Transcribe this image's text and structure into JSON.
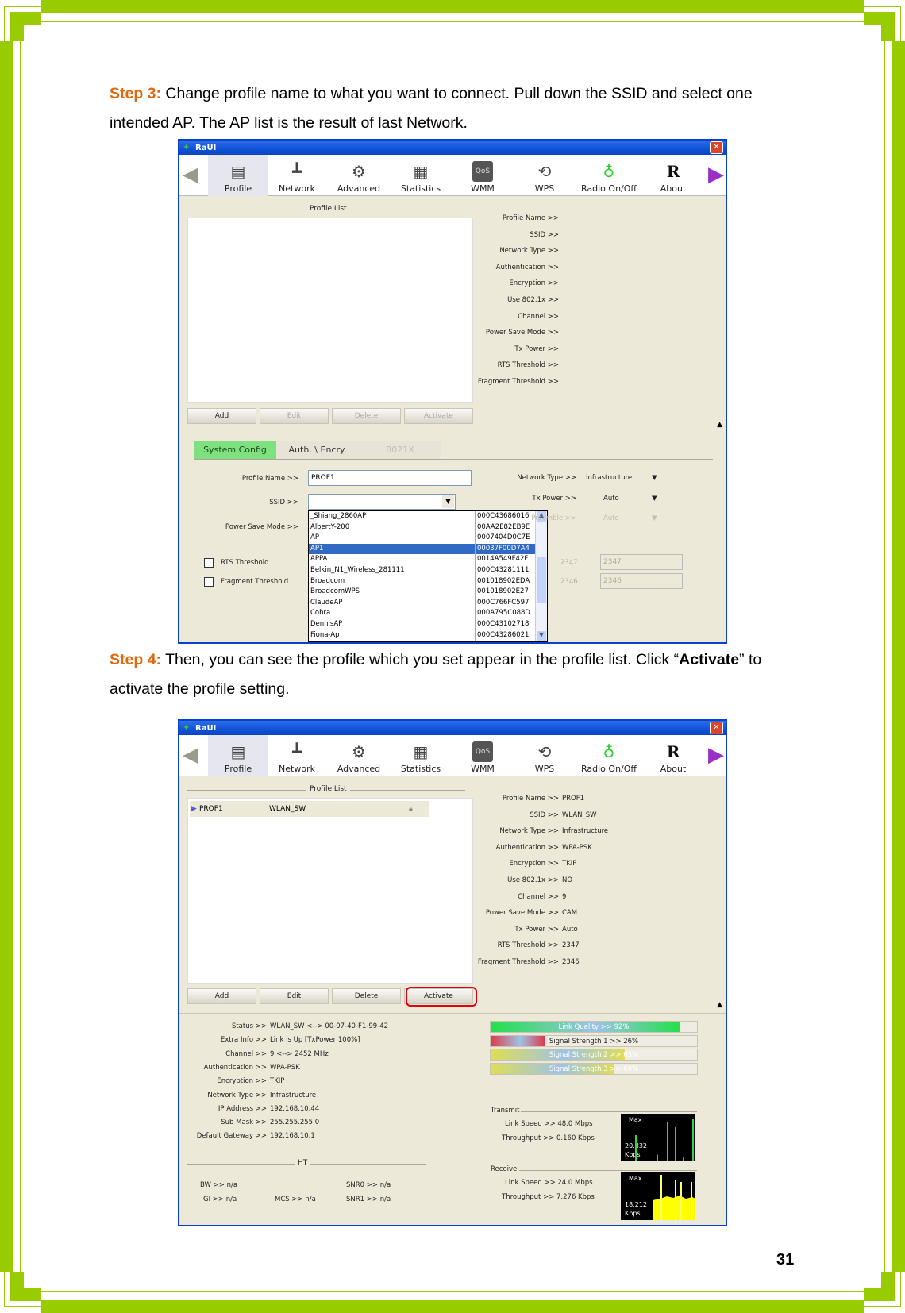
{
  "page": {
    "page_number": "31",
    "border_color": "#99cc00",
    "step3": {
      "label": "Step 3:",
      "text": " Change profile name to what you want to connect. Pull down the SSID and select one intended AP. The AP list is the result of last Network."
    },
    "step4": {
      "label": "Step 4:",
      "text_before": " Then, you can see the profile which you set appear in the profile list. Click “",
      "bold": "Activate",
      "text_after": "” to activate the profile setting."
    }
  },
  "app": {
    "title": "RaUI",
    "toolbar": [
      "Profile",
      "Network",
      "Advanced",
      "Statistics",
      "WMM",
      "WPS",
      "Radio On/Off",
      "About"
    ],
    "profile_list_title": "Profile List",
    "buttons": {
      "add": "Add",
      "edit": "Edit",
      "delete": "Delete",
      "activate": "Activate"
    }
  },
  "screen1": {
    "detail_labels": [
      "Profile Name >>",
      "SSID >>",
      "Network Type >>",
      "Authentication >>",
      "Encryption >>",
      "Use 802.1x >>",
      "Channel >>",
      "Power Save Mode >>",
      "Tx Power >>",
      "RTS Threshold >>",
      "Fragment Threshold >>"
    ],
    "tabs": [
      "System Config",
      "Auth. \\ Encry.",
      "8021X"
    ],
    "form": {
      "profile_name_label": "Profile Name >>",
      "profile_name_value": "PROF1",
      "ssid_label": "SSID >>",
      "ssid_value": "",
      "power_save_label": "Power Save Mode >>",
      "rts_label": "RTS Threshold",
      "frag_label": "Fragment Threshold",
      "network_type_label": "Network Type >>",
      "network_type_value": "Infrastructure",
      "tx_power_label": "Tx Power >>",
      "tx_power_value": "Auto",
      "preamble_label": "Preamble >>",
      "preamble_value": "Auto",
      "rts_value": "2347",
      "rts_input": "2347",
      "frag_value": "2346",
      "frag_input": "2346"
    },
    "ap_list": [
      {
        "ssid": "_Shiang_2860AP",
        "mac": "000C43686016"
      },
      {
        "ssid": "AlbertY-200",
        "mac": "00AA2E82EB9E"
      },
      {
        "ssid": "AP",
        "mac": "0007404D0C7E"
      },
      {
        "ssid": "AP1",
        "mac": "00037F00D7A4",
        "selected": true
      },
      {
        "ssid": "APPA",
        "mac": "0014A549F42F"
      },
      {
        "ssid": "Belkin_N1_Wireless_281111",
        "mac": "000C43281111"
      },
      {
        "ssid": "Broadcom",
        "mac": "001018902EDA"
      },
      {
        "ssid": "BroadcomWPS",
        "mac": "001018902E27"
      },
      {
        "ssid": "ClaudeAP",
        "mac": "000C766FC597"
      },
      {
        "ssid": "Cobra",
        "mac": "000A795C088D"
      },
      {
        "ssid": "DennisAP",
        "mac": "000C43102718"
      },
      {
        "ssid": "Fiona-Ap",
        "mac": "000C43286021"
      }
    ]
  },
  "screen2": {
    "profile_row": {
      "name": "PROF1",
      "ssid": "WLAN_SW"
    },
    "details": [
      {
        "label": "Profile Name >>",
        "value": "PROF1"
      },
      {
        "label": "SSID >>",
        "value": "WLAN_SW"
      },
      {
        "label": "Network Type >>",
        "value": "Infrastructure"
      },
      {
        "label": "Authentication >>",
        "value": "WPA-PSK"
      },
      {
        "label": "Encryption >>",
        "value": "TKIP"
      },
      {
        "label": "Use 802.1x >>",
        "value": "NO"
      },
      {
        "label": "Channel >>",
        "value": "9"
      },
      {
        "label": "Power Save Mode >>",
        "value": "CAM"
      },
      {
        "label": "Tx Power >>",
        "value": "Auto"
      },
      {
        "label": "RTS Threshold >>",
        "value": "2347"
      },
      {
        "label": "Fragment Threshold >>",
        "value": "2346"
      }
    ],
    "status": [
      {
        "label": "Status >>",
        "value": "WLAN_SW <--> 00-07-40-F1-99-42"
      },
      {
        "label": "Extra Info >>",
        "value": "Link is Up [TxPower:100%]"
      },
      {
        "label": "Channel >>",
        "value": "9 <--> 2452 MHz"
      },
      {
        "label": "Authentication >>",
        "value": "WPA-PSK"
      },
      {
        "label": "Encryption >>",
        "value": "TKIP"
      },
      {
        "label": "Network Type >>",
        "value": "Infrastructure"
      },
      {
        "label": "IP Address >>",
        "value": "192.168.10.44"
      },
      {
        "label": "Sub Mask >>",
        "value": "255.255.255.0"
      },
      {
        "label": "Default Gateway >>",
        "value": "192.168.10.1"
      }
    ],
    "ht": {
      "title": "HT",
      "bw": "BW >> n/a",
      "gi": "GI >> n/a",
      "mcs": "MCS >> n/a",
      "snr0": "SNR0 >> n/a",
      "snr1": "SNR1 >> n/a"
    },
    "signal": [
      {
        "label": "Link Quality >> 92%",
        "percent": 92,
        "color": "#22e04a"
      },
      {
        "label": "Signal Strength 1 >> 26%",
        "percent": 26,
        "color": "#e03a4a"
      },
      {
        "label": "Signal Strength 2 >> 65%",
        "percent": 65,
        "color": "#e0dd55"
      },
      {
        "label": "Signal Strength 3 >> 60%",
        "percent": 60,
        "color": "#e0dd55"
      }
    ],
    "transmit": {
      "title": "Transmit",
      "link_speed": "Link Speed >> 48.0 Mbps",
      "throughput": "Throughput >> 0.160 Kbps",
      "max_label": "Max",
      "max_value": "20.832",
      "unit": "Kbps"
    },
    "receive": {
      "title": "Receive",
      "link_speed": "Link Speed >> 24.0 Mbps",
      "throughput": "Throughput >> 7.276 Kbps",
      "max_label": "Max",
      "max_value": "18.212",
      "unit": "Kbps"
    }
  }
}
